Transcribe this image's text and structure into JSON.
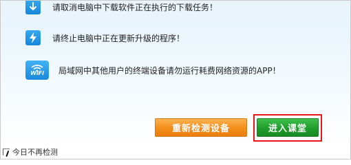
{
  "tips": [
    {
      "text": "请取消电脑中下载软件正在执行的下载任务！",
      "icon": "download-arrow-icon"
    },
    {
      "text": "请终止电脑中正在更新升级的程序！",
      "icon": "lightning-icon"
    },
    {
      "text": "局域网中其他用户的终端设备请勿运行耗费网络资源的APP！",
      "icon": "wifi-icon",
      "icon_label": "WiFi"
    }
  ],
  "buttons": {
    "recheck": "重新检测设备",
    "enter_class": "进入课堂"
  },
  "footer": {
    "checkbox_label": "今日不再检测"
  },
  "colors": {
    "icon_blue": "#1687d9",
    "recheck_orange": "#f38d1a",
    "enter_green": "#1f9d2c",
    "highlight_red": "#e8151b"
  }
}
